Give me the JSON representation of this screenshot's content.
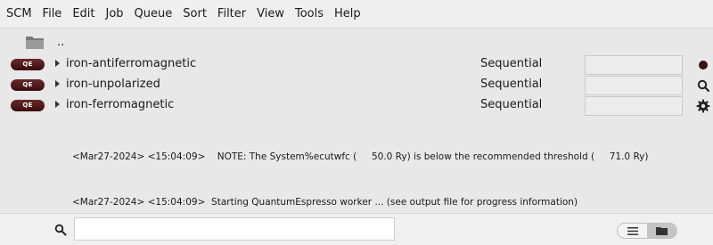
{
  "menu": [
    "SCM",
    "File",
    "Edit",
    "Job",
    "Queue",
    "Sort",
    "Filter",
    "View",
    "Tools",
    "Help"
  ],
  "parent": {
    "label": "..",
    "icon": "folder-icon"
  },
  "jobs": [
    {
      "badge": "QE",
      "name": "iron-antiferromagnetic",
      "mode": "Sequential",
      "status_icon": "status-dot-icon"
    },
    {
      "badge": "QE",
      "name": "iron-unpolarized",
      "mode": "Sequential",
      "status_icon": "magnifier-icon"
    },
    {
      "badge": "QE",
      "name": "iron-ferromagnetic",
      "mode": "Sequential",
      "status_icon": "gear-icon"
    }
  ],
  "log": [
    "<Mar27-2024> <15:04:09>    NOTE: The System%ecutwfc (     50.0 Ry) is below the recommended threshold (     71.0 Ry)",
    "<Mar27-2024> <15:04:09>  Starting QuantumEspresso worker ... (see output file for progress information)"
  ],
  "bottom": {
    "search_value": "",
    "search_placeholder": ""
  },
  "colors": {
    "badge": "#4a1515",
    "icon": "#333333"
  }
}
